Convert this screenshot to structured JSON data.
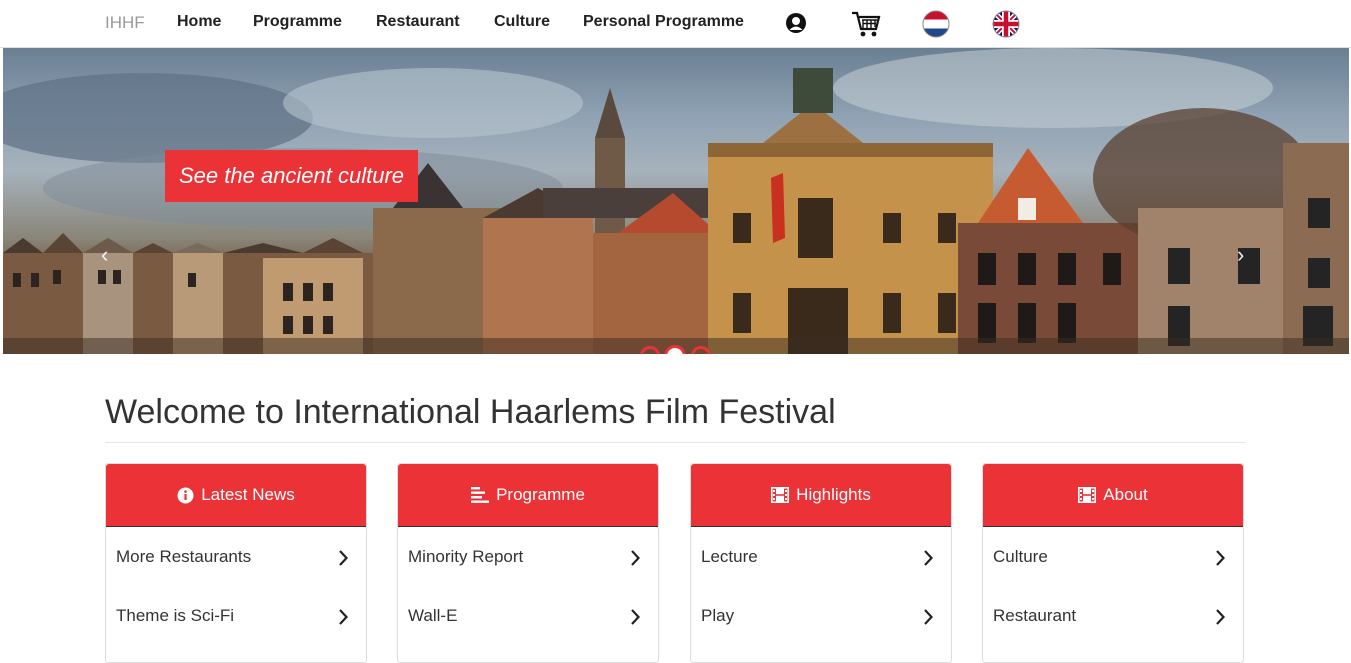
{
  "nav": {
    "brand": "IHHF",
    "links": [
      "Home",
      "Programme",
      "Restaurant",
      "Culture",
      "Personal Programme"
    ],
    "icons": [
      "user-icon",
      "cart-icon",
      "netherlands-flag-icon",
      "uk-flag-icon"
    ]
  },
  "hero": {
    "caption": "See the ancient culture",
    "prev": "‹",
    "next": "›",
    "slides_total": 3,
    "active_slide": 2
  },
  "welcome": {
    "title": "Welcome to International Haarlems Film Festival"
  },
  "panels": [
    {
      "title": "Latest News",
      "icon": "info-icon",
      "items": [
        "More Restaurants",
        "Theme is Sci-Fi"
      ]
    },
    {
      "title": "Programme",
      "icon": "list-icon",
      "items": [
        "Minority Report",
        "Wall-E"
      ]
    },
    {
      "title": "Highlights",
      "icon": "film-icon",
      "items": [
        "Lecture",
        "Play"
      ]
    },
    {
      "title": "About",
      "icon": "film-icon",
      "items": [
        "Culture",
        "Restaurant"
      ]
    }
  ],
  "colors": {
    "accent": "#ea3237",
    "nav_text": "#222222",
    "brand_text": "#999999"
  }
}
